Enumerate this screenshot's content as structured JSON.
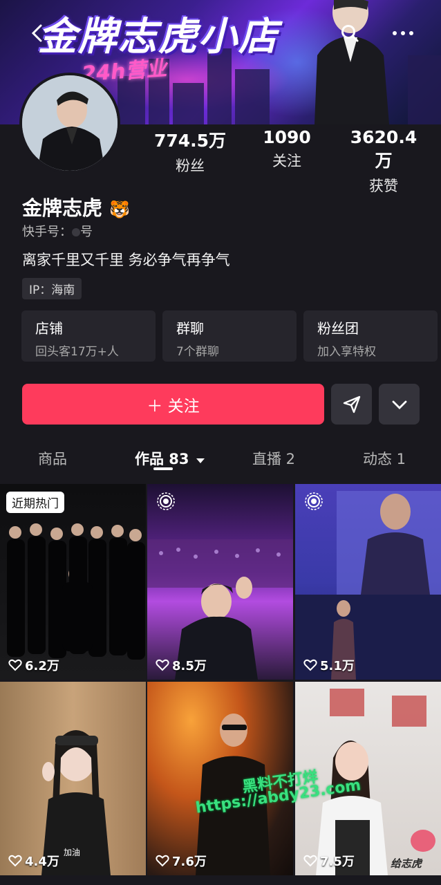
{
  "banner": {
    "title": "金牌志虎小店",
    "subtitle": "24h营业"
  },
  "profile": {
    "name": "金牌志虎",
    "emoji": "🐯",
    "kuaishou_id_label": "快手号：",
    "kuaishou_id_suffix": "号",
    "bio": "离家千里又千里 务必争气再争气",
    "ip_label": "IP：海南"
  },
  "stats": [
    {
      "value": "774.5万",
      "label": "粉丝"
    },
    {
      "value": "1090",
      "label": "关注"
    },
    {
      "value": "3620.4万",
      "label": "获赞"
    }
  ],
  "cards": [
    {
      "title": "店铺",
      "subtitle": "回头客17万+人"
    },
    {
      "title": "群聊",
      "subtitle": "7个群聊"
    },
    {
      "title": "粉丝团",
      "subtitle": "加入享特权"
    }
  ],
  "actions": {
    "follow_label": "＋ 关注"
  },
  "tabs": [
    {
      "label": "商品"
    },
    {
      "label": "作品 83"
    },
    {
      "label": "直播 2"
    },
    {
      "label": "动态 1"
    }
  ],
  "grid": {
    "hot_chip": "近期热门",
    "items": [
      {
        "likes": "6.2万"
      },
      {
        "likes": "8.5万"
      },
      {
        "likes": "5.1万"
      },
      {
        "likes": "4.4万"
      },
      {
        "likes": "7.6万"
      },
      {
        "likes": "7.5万"
      }
    ],
    "cheer_text": "加油",
    "caption6": "给志虎"
  },
  "watermark": {
    "line1": "黑料不打烊",
    "line2": "https://abdy23.com"
  },
  "colors": {
    "accent": "#fe3b5c",
    "background": "#19181e",
    "card": "#26252c"
  },
  "icons": [
    "back-icon",
    "search-icon",
    "more-icon",
    "send-icon",
    "chevron-down-icon",
    "heart-icon",
    "live-icon",
    "caret-down-icon"
  ]
}
